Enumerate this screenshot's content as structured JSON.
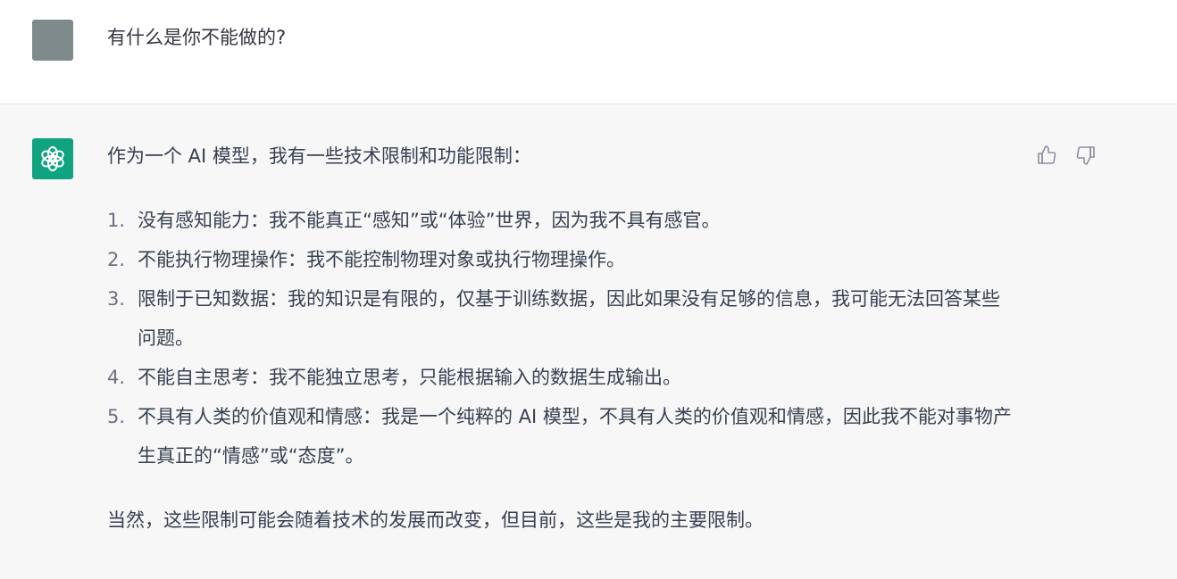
{
  "user_message": {
    "text": "有什么是你不能做的?"
  },
  "assistant_message": {
    "intro": "作为一个 AI 模型，我有一些技术限制和功能限制：",
    "items": [
      {
        "number": "1.",
        "text": "没有感知能力：我不能真正“感知”或“体验”世界，因为我不具有感官。"
      },
      {
        "number": "2.",
        "text": "不能执行物理操作：我不能控制物理对象或执行物理操作。"
      },
      {
        "number": "3.",
        "text": "限制于已知数据：我的知识是有限的，仅基于训练数据，因此如果没有足够的信息，我可能无法回答某些问题。"
      },
      {
        "number": "4.",
        "text": "不能自主思考：我不能独立思考，只能根据输入的数据生成输出。"
      },
      {
        "number": "5.",
        "text": "不具有人类的价值观和情感：我是一个纯粹的 AI 模型，不具有人类的价值观和情感，因此我不能对事物产生真正的“情感”或“态度”。"
      }
    ],
    "closing": "当然，这些限制可能会随着技术的发展而改变，但目前，这些是我的主要限制。"
  },
  "icons": {
    "user_avatar": "user-avatar",
    "assistant_avatar": "openai-logo-icon",
    "thumbs_up": "thumbs-up-icon",
    "thumbs_down": "thumbs-down-icon"
  },
  "colors": {
    "assistant_avatar_bg": "#10a37f",
    "user_avatar_bg": "#7f8a8c",
    "assistant_row_bg": "#f7f7f8"
  }
}
